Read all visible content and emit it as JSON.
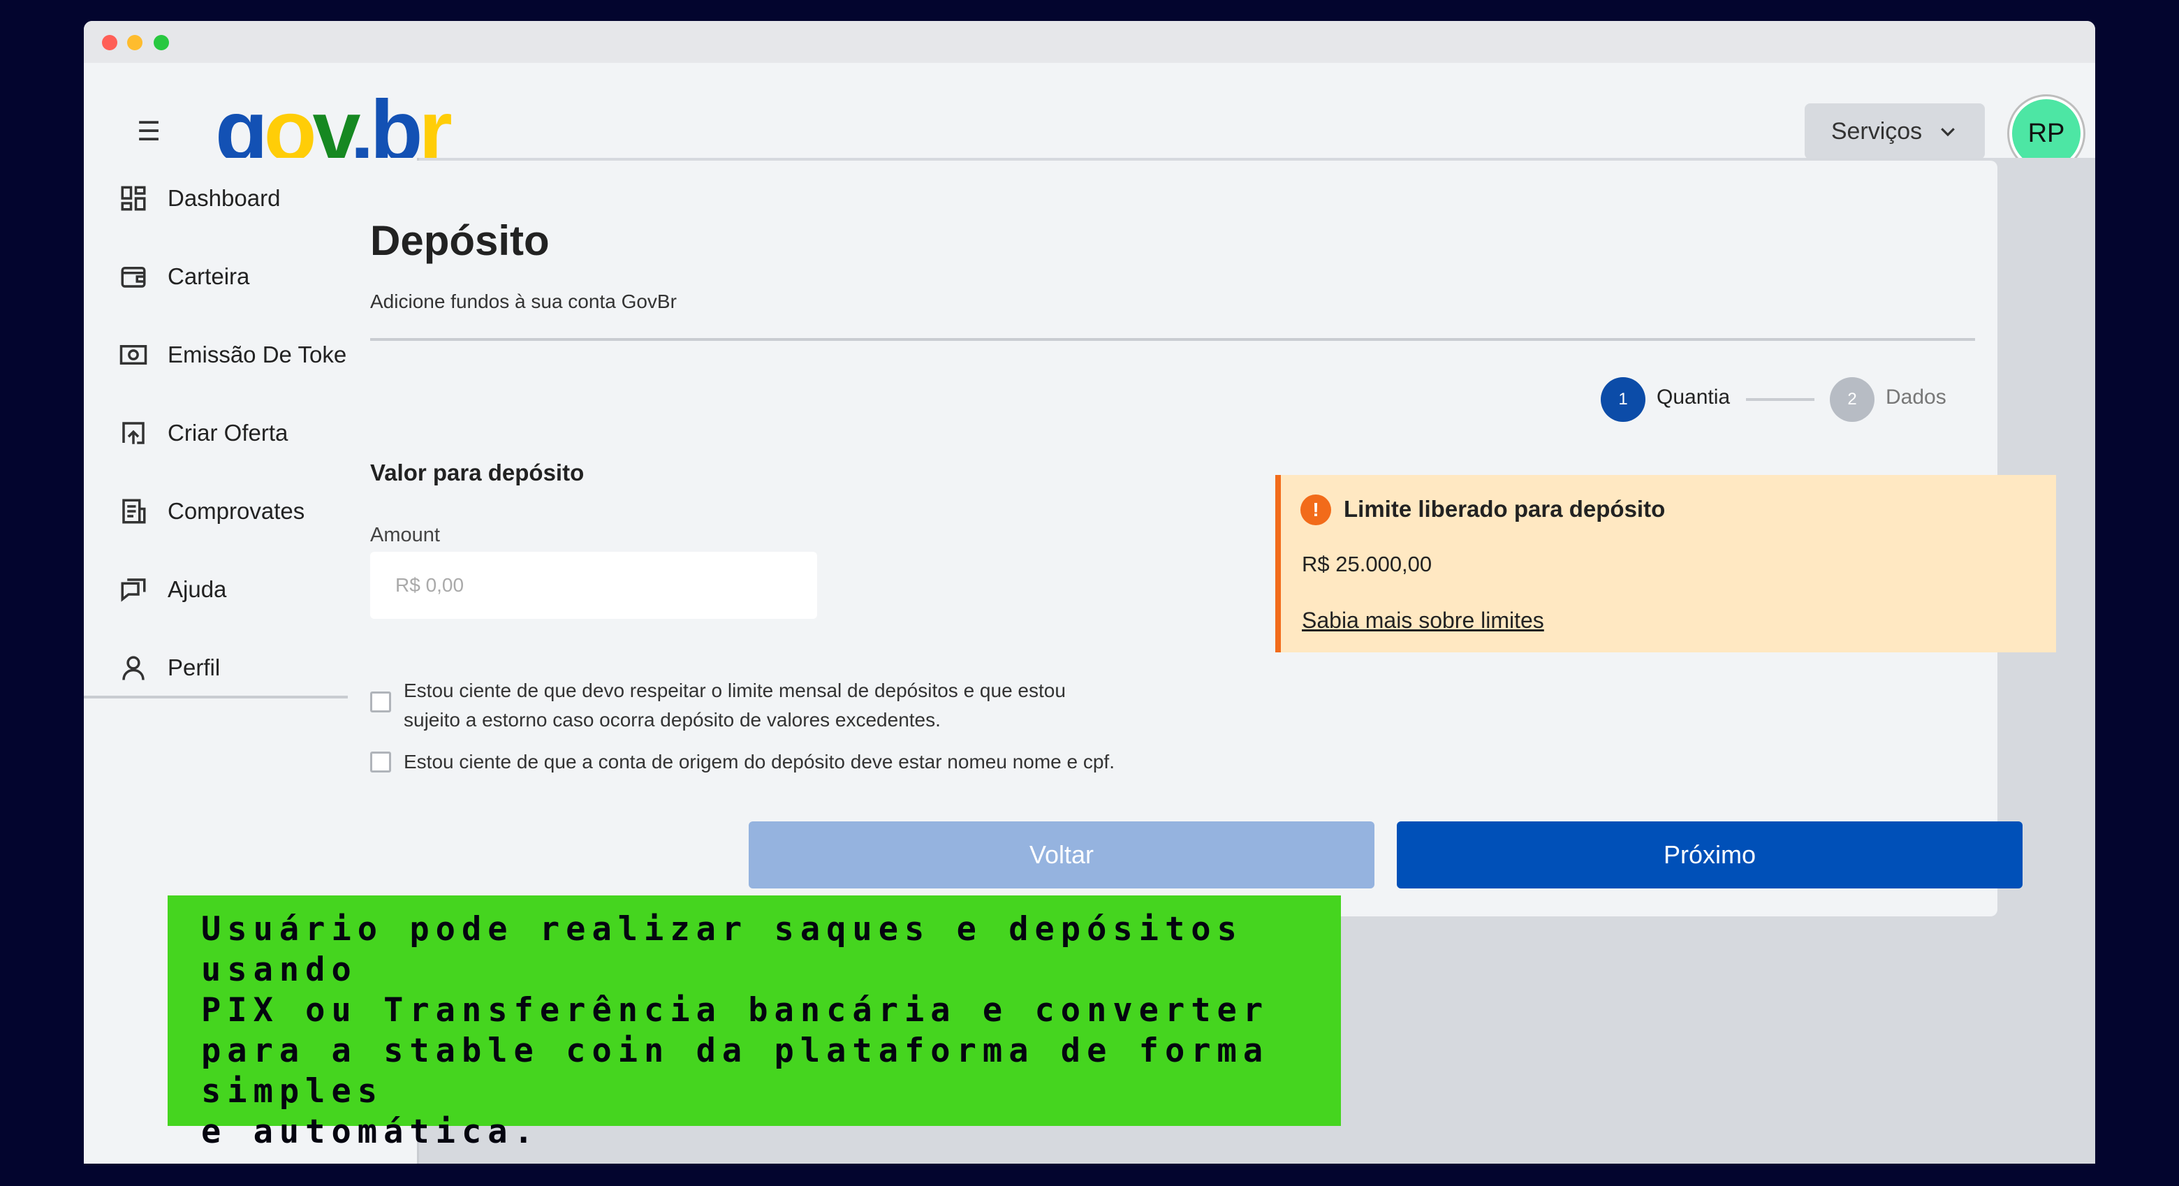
{
  "header": {
    "menu_icon": "☰",
    "logo": {
      "g": "g",
      "o": "o",
      "v": "v",
      "dot": ".",
      "b": "b",
      "r": "r"
    },
    "services_label": "Serviços",
    "avatar_initials": "RP"
  },
  "sidebar": {
    "items": [
      {
        "label": "Dashboard",
        "icon": "dashboard-icon"
      },
      {
        "label": "Carteira",
        "icon": "wallet-icon"
      },
      {
        "label": "Emissão De Tokens",
        "icon": "token-icon"
      },
      {
        "label": "Criar Oferta",
        "icon": "upload-icon"
      },
      {
        "label": "Comprovates",
        "icon": "receipt-icon"
      },
      {
        "label": "Ajuda",
        "icon": "chat-icon"
      },
      {
        "label": "Perfil",
        "icon": "user-icon"
      }
    ]
  },
  "page": {
    "title": "Depósito",
    "subtitle": "Adicione fundos à sua conta GovBr"
  },
  "stepper": {
    "steps": [
      {
        "number": "1",
        "label": "Quantia",
        "active": true
      },
      {
        "number": "2",
        "label": "Dados",
        "active": false
      }
    ]
  },
  "form": {
    "section_title": "Valor para depósito",
    "amount_label": "Amount",
    "amount_placeholder": "R$ 0,00",
    "checkbox1_line1": "Estou ciente de que devo respeitar o limite mensal de depósitos e que estou",
    "checkbox1_line2": "sujeito a estorno caso ocorra depósito de valores excedentes.",
    "checkbox2": "Estou ciente de que a conta de origem do depósito deve estar nomeu nome e cpf."
  },
  "alert": {
    "icon": "!",
    "title": "Limite liberado para depósito",
    "limit": "R$ 25.000,00",
    "link": "Sabia mais sobre limites"
  },
  "buttons": {
    "back": "Voltar",
    "next": "Próximo"
  },
  "overlay": {
    "text": "Usuário pode realizar saques e depósitos usando\nPIX ou Transferência bancária e converter\npara a stable coin da plataforma de forma simples\ne automática."
  },
  "colors": {
    "primary": "#0050b8",
    "primary_light": "#95b3df",
    "alert_bg": "#ffe8c2",
    "alert_accent": "#f26b1a",
    "overlay_bg": "#45d51f",
    "avatar_bg": "#4de6a4"
  }
}
